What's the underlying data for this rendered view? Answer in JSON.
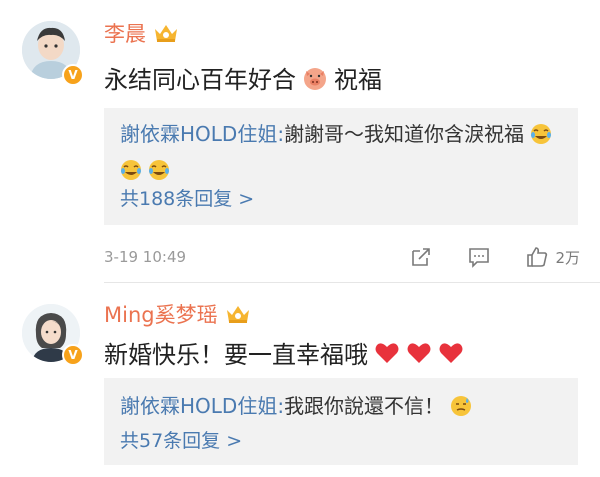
{
  "comments": [
    {
      "user": "李晨",
      "text": "永结同心百年好合",
      "text_suffix": "祝福",
      "reply_author": "謝依霖HOLD住姐:",
      "reply_text": "謝謝哥～我知道你含淚祝福",
      "reply_count_label": "共188条回复 >",
      "timestamp": "3-19 10:49",
      "like_count": "2万"
    },
    {
      "user": "Ming奚梦瑶",
      "text": "新婚快乐！要一直幸福哦",
      "reply_author": "謝依霖HOLD住姐:",
      "reply_text": "我跟你說還不信！",
      "reply_count_label": "共57条回复 >"
    }
  ],
  "colors": {
    "username": "#eb7350",
    "link": "#4a7ab0",
    "reply_bg": "#f2f2f2",
    "verified_badge": "#f7a21b",
    "heart": "#e8323c"
  },
  "icons": [
    "crown-badge-icon",
    "verified-v-icon",
    "share-icon",
    "comment-icon",
    "like-icon",
    "cry-laugh-emoji",
    "heart-emoji",
    "pig-emoji",
    "sweat-emoji"
  ]
}
